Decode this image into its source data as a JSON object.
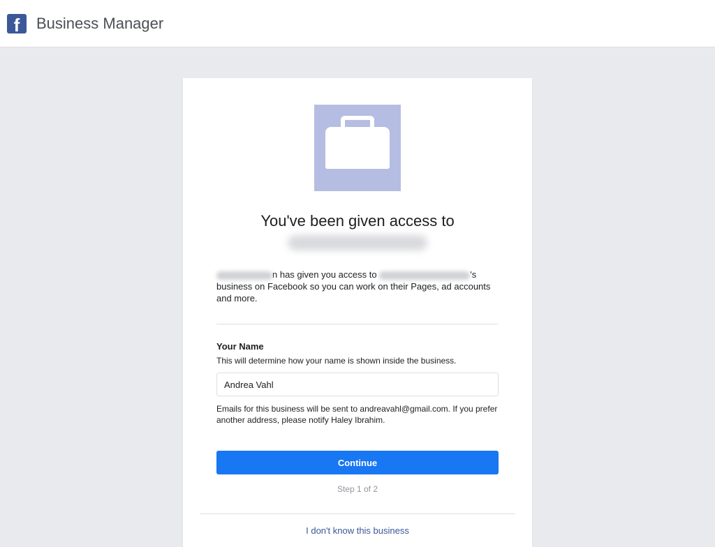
{
  "header": {
    "title": "Business Manager"
  },
  "card": {
    "heading_line1": "You've been given access to",
    "desc_part1": "n",
    "desc_part2": " has given you access to ",
    "desc_part3": "'s business on Facebook so you can work on their Pages, ad accounts and more.",
    "name_label": "Your Name",
    "name_hint": "This will determine how your name is shown inside the business.",
    "name_value": "Andrea Vahl",
    "email_note": "Emails for this business will be sent to andreavahl@gmail.com. If you prefer another address, please notify Haley Ibrahim.",
    "continue_label": "Continue",
    "step_label": "Step 1 of 2",
    "unknown_link": "I don't know this business"
  }
}
